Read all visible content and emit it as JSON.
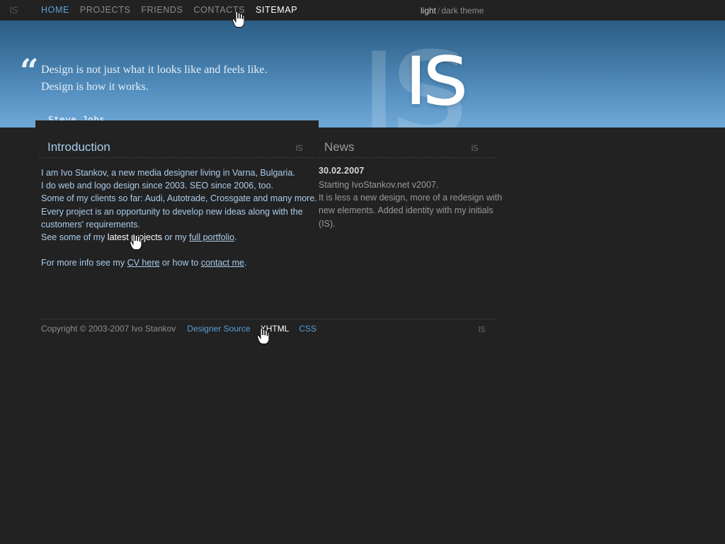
{
  "navbar": {
    "logo": "ıs",
    "links": [
      {
        "label": "HOME",
        "state": "link"
      },
      {
        "label": "PROJECTS",
        "state": "default"
      },
      {
        "label": "FRIENDS",
        "state": "default"
      },
      {
        "label": "CONTACTS",
        "state": "default"
      },
      {
        "label": "SITEMAP",
        "state": "active"
      }
    ],
    "theme": {
      "light": "light",
      "separator": "/",
      "dark": "dark theme"
    }
  },
  "hero": {
    "logo_big": "ıs",
    "logo_small": "ıs",
    "quote_mark": "“",
    "quote_line1": "Design is not just what it looks like and feels like.",
    "quote_line2": "Design is how it works.",
    "author": "Steve Jobs"
  },
  "introduction": {
    "heading": "Introduction",
    "logo": "ıs",
    "line1": "I am Ivo Stankov, a new media designer living in Varna, Bulgaria.",
    "line2": "I do web and logo design since 2003. SEO since 2006, too.",
    "line3": "Some of my clients so far: Audi, Autotrade, Crossgate and many more.",
    "line4": "Every project is an opportunity to develop new ideas along with the",
    "line5": "customers' requirements.",
    "line6_pre": "See some of my ",
    "line6_link_hover": "latest projects",
    "line6_mid": " or my ",
    "line6_link": "full portfolio",
    "line6_post": ".",
    "more_pre": "For more info see my ",
    "more_link1": "CV here",
    "more_mid": " or how to ",
    "more_link2": "contact me",
    "more_post": "."
  },
  "news": {
    "heading": "News",
    "logo": "ıs",
    "date": "30.02.2007",
    "line1": "Starting IvoStankov.net v2007.",
    "line2": "It is less a new design, more of a redesign with",
    "line3": "new elements. Added identity with my initials (IS)."
  },
  "footer": {
    "copyright": "Copyright © 2003-2007 Ivo Stankov",
    "links": [
      {
        "label": "Designer Source",
        "state": "link"
      },
      {
        "label": "XHTML",
        "state": "hover"
      },
      {
        "label": "CSS",
        "state": "link"
      }
    ],
    "logo": "ıs"
  },
  "colors": {
    "background": "#222222",
    "hero_gradient_top": "#2c5d85",
    "hero_gradient_bottom": "#6ea8d6",
    "accent_blue": "#5b9fd6",
    "body_blue": "#aaccea",
    "muted_grey": "#8d8d8d"
  }
}
